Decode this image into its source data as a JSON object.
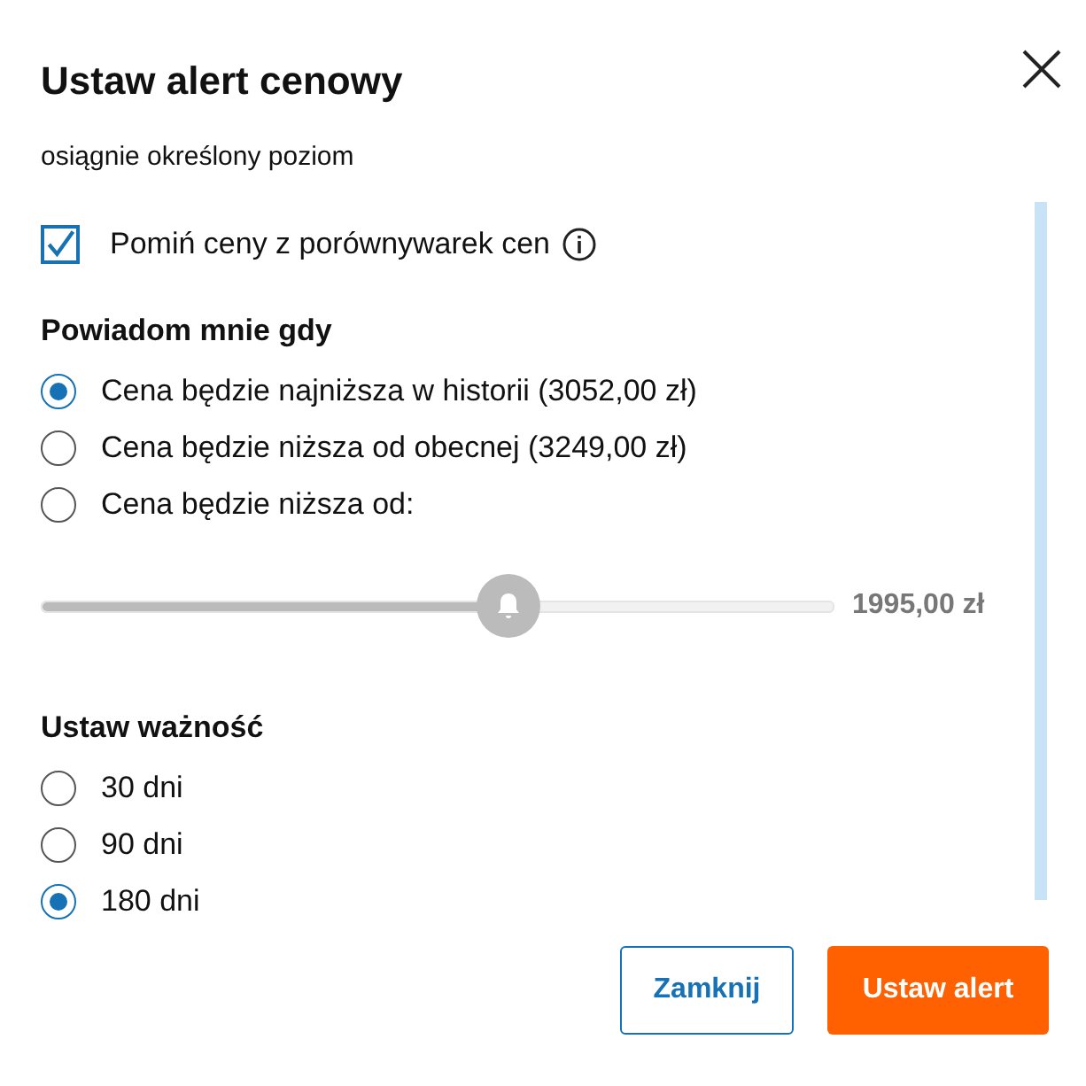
{
  "dialog": {
    "title": "Ustaw alert cenowy"
  },
  "intro": "osiągnie określony poziom",
  "skip_comparison": {
    "label": "Pomiń ceny z porównywarek cen",
    "checked": true
  },
  "notify": {
    "heading": "Powiadom mnie gdy",
    "options": [
      {
        "label": "Cena będzie najniższa w historii (3052,00 zł)",
        "selected": true
      },
      {
        "label": "Cena będzie niższa od obecnej (3249,00 zł)",
        "selected": false
      },
      {
        "label": "Cena będzie niższa od:",
        "selected": false
      }
    ]
  },
  "price_slider": {
    "level": 0.59,
    "disabled": true,
    "reading": "1995,00 zł"
  },
  "validity": {
    "heading": "Ustaw ważność",
    "options": [
      {
        "label": "30 dni",
        "selected": false
      },
      {
        "label": "90 dni",
        "selected": false
      },
      {
        "label": "180 dni",
        "selected": true
      }
    ]
  },
  "buttons": [
    {
      "label": "Zamknij",
      "kind": "secondary"
    },
    {
      "label": "Ustaw alert",
      "kind": "primary"
    }
  ]
}
